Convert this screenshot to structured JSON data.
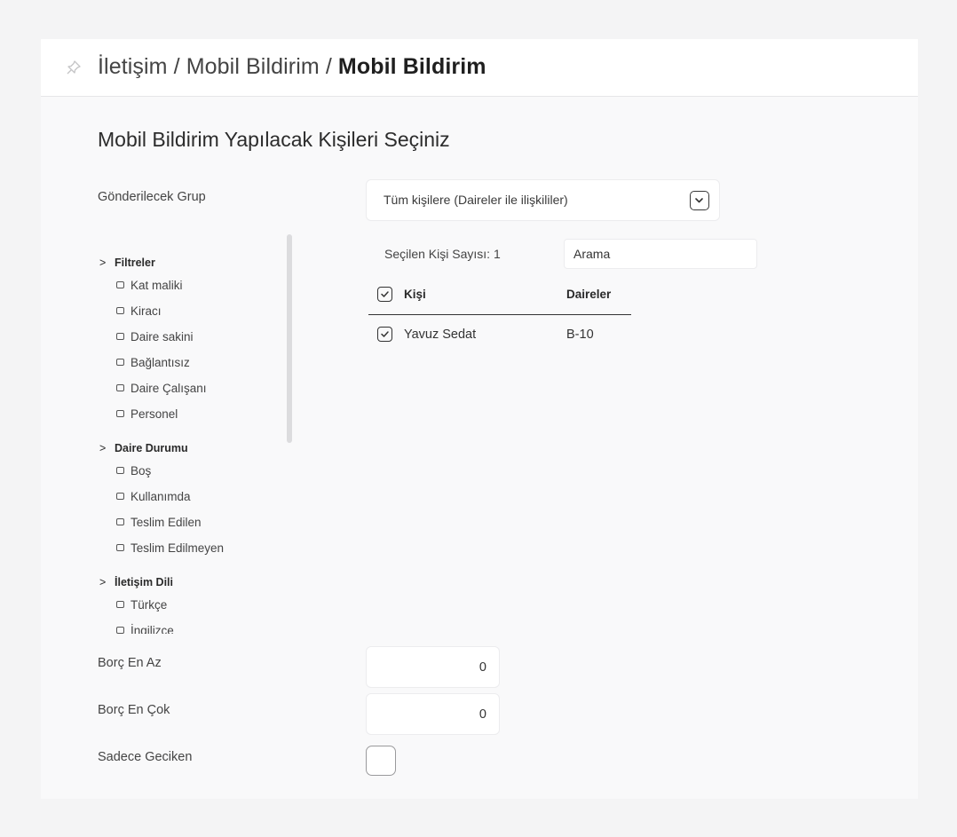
{
  "breadcrumb": {
    "part1": "İletişim",
    "sep1": " / ",
    "part2": "Mobil Bildirim",
    "sep2": " / ",
    "current": "Mobil Bildirim"
  },
  "title": "Mobil Bildirim Yapılacak Kişileri Seçiniz",
  "group": {
    "label": "Gönderilecek Grup",
    "selected": "Tüm kişilere (Daireler ile ilişkililer)"
  },
  "filters": [
    {
      "name": "Filtreler",
      "options": [
        "Kat maliki",
        "Kiracı",
        "Daire sakini",
        "Bağlantısız",
        "Daire Çalışanı",
        "Personel"
      ]
    },
    {
      "name": "Daire Durumu",
      "options": [
        "Boş",
        "Kullanımda",
        "Teslim Edilen",
        "Teslim Edilmeyen"
      ]
    },
    {
      "name": "İletişim Dili",
      "options": [
        "Türkçe",
        "İngilizce"
      ]
    }
  ],
  "selection": {
    "count_text": "Seçilen Kişi Sayısı: 1",
    "search_placeholder": "Arama"
  },
  "table": {
    "columns": [
      "Kişi",
      "Daireler"
    ],
    "rows": [
      {
        "person": "Yavuz Sedat",
        "unit": "B-10",
        "checked": true
      }
    ]
  },
  "debt_min": {
    "label": "Borç En Az",
    "value": "0"
  },
  "debt_max": {
    "label": "Borç En Çok",
    "value": "0"
  },
  "late_only": {
    "label": "Sadece Geciken",
    "checked": false
  },
  "icons": {
    "pin": "pin-icon",
    "chevron": "chevron-down-icon",
    "check": "check-icon",
    "arrow": "chevron-right-icon"
  }
}
